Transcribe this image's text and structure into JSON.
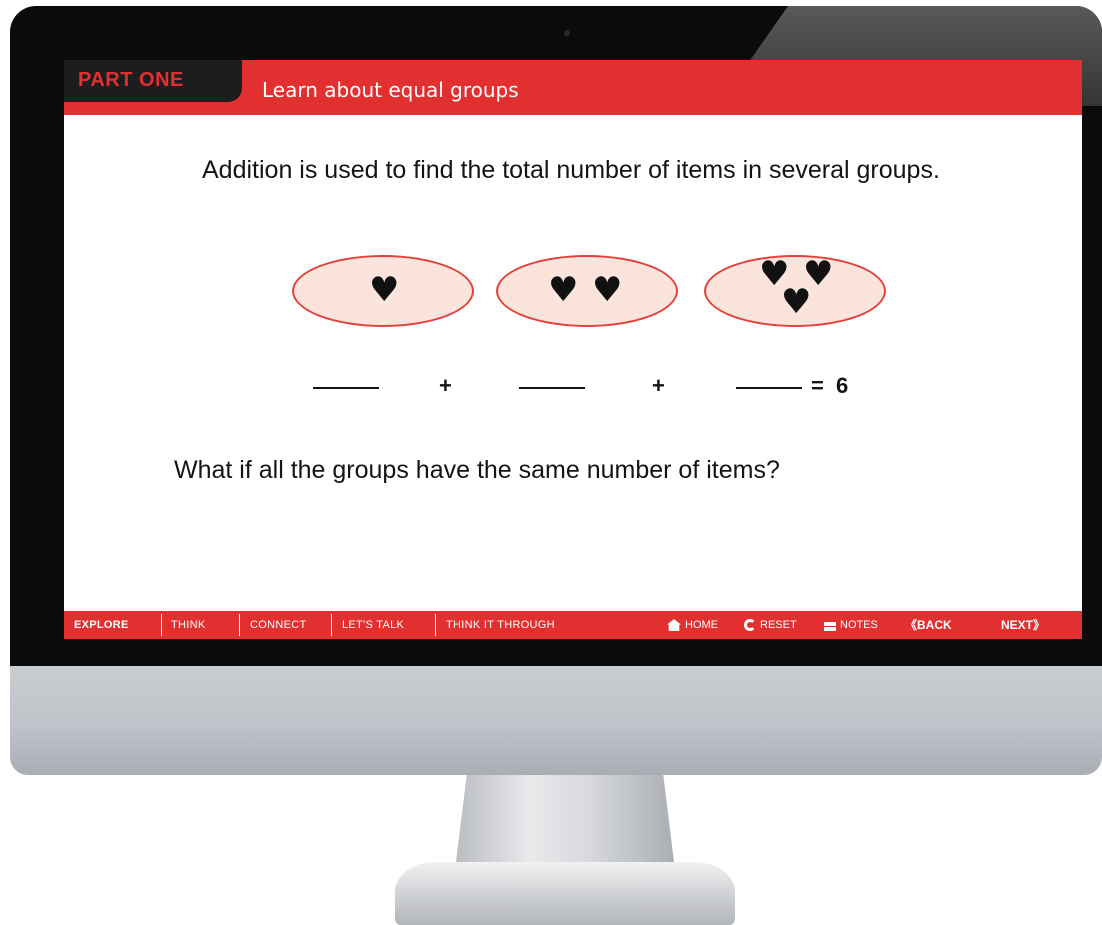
{
  "screen": {
    "part_label": "PART ONE",
    "title": "Learn about equal groups",
    "intro_text": "Addition is used to find the total number of items in several groups.",
    "groups": [
      {
        "hearts": 1
      },
      {
        "hearts": 2
      },
      {
        "hearts": 3
      }
    ],
    "heart_icon": "heart-icon",
    "equation": {
      "plus_1": "+",
      "plus_2": "+",
      "equals": "=",
      "total": "6"
    },
    "question": "What if all the groups have the same number of items?"
  },
  "nav": {
    "tabs": [
      {
        "label": "EXPLORE",
        "active": true
      },
      {
        "label": "THINK",
        "active": false
      },
      {
        "label": "CONNECT",
        "active": false
      },
      {
        "label": "LET'S TALK",
        "active": false
      },
      {
        "label": "THINK IT THROUGH",
        "active": false
      }
    ],
    "controls": {
      "home": "HOME",
      "reset": "RESET",
      "notes": "NOTES",
      "back": "BACK",
      "next": "NEXT",
      "back_chevron": "《",
      "next_chevron": "》"
    }
  },
  "colors": {
    "accent_red": "#e23030",
    "oval_fill": "#fbe4dc",
    "oval_border": "#e3403c"
  }
}
